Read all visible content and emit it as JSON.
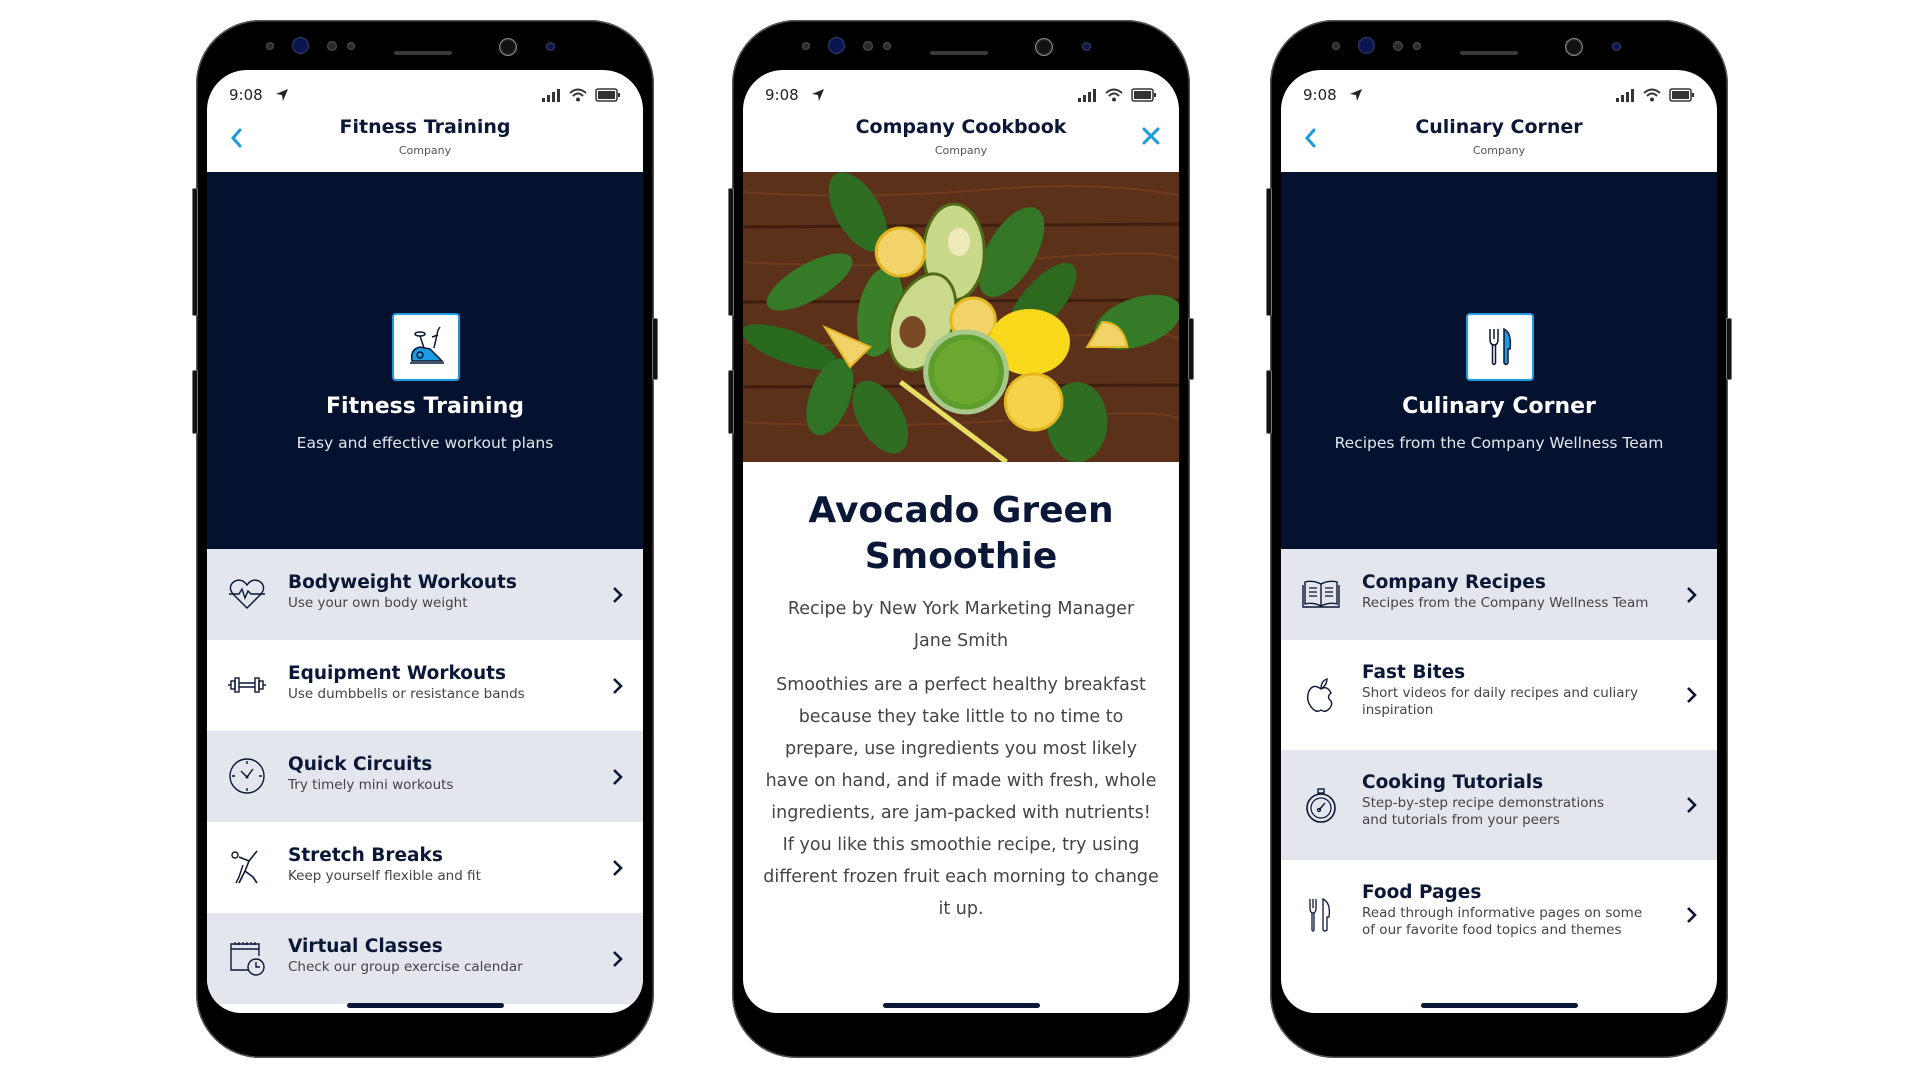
{
  "colors": {
    "accent": "#1b9be0",
    "navy": "#0b1736",
    "hero_bg": "#04122f",
    "row_alt": "#e3e6ec"
  },
  "phones": [
    {
      "status": {
        "time": "9:08",
        "icons": [
          "location-arrow-icon",
          "signal-icon",
          "wifi-icon",
          "battery-icon"
        ]
      },
      "header": {
        "title": "Fitness Training",
        "subtitle": "Company",
        "nav_icon": "back-chevron-icon"
      },
      "hero": {
        "icon": "exercise-bike-icon",
        "title": "Fitness Training",
        "subtitle": "Easy and effective workout plans"
      },
      "items": [
        {
          "icon": "heart-pulse-icon",
          "title": "Bodyweight Workouts",
          "subtitle": "Use your own body weight"
        },
        {
          "icon": "dumbbell-icon",
          "title": "Equipment Workouts",
          "subtitle": "Use dumbbells or resistance bands"
        },
        {
          "icon": "clock-icon",
          "title": "Quick Circuits",
          "subtitle": "Try timely mini workouts"
        },
        {
          "icon": "stretching-person-icon",
          "title": "Stretch Breaks",
          "subtitle": "Keep yourself flexible and fit"
        },
        {
          "icon": "calendar-clock-icon",
          "title": "Virtual Classes",
          "subtitle": "Check our group exercise calendar"
        }
      ]
    },
    {
      "status": {
        "time": "9:08",
        "icons": [
          "location-arrow-icon",
          "signal-icon",
          "wifi-icon",
          "battery-icon"
        ]
      },
      "header": {
        "title": "Company Cookbook",
        "subtitle": "Company",
        "nav_icon": "close-icon"
      },
      "article": {
        "image": "avocado-smoothie-photo",
        "title": "Avocado Green Smoothie",
        "byline": "Recipe by New York Marketing Manager Jane Smith",
        "body": "Smoothies are a perfect healthy breakfast because they take little to no time to prepare, use ingredients you most likely have on hand, and if made with fresh, whole ingredients, are jam-packed with nutrients! If you like this smoothie recipe, try using different frozen fruit each morning to change it up."
      }
    },
    {
      "status": {
        "time": "9:08",
        "icons": [
          "location-arrow-icon",
          "signal-icon",
          "wifi-icon",
          "battery-icon"
        ]
      },
      "header": {
        "title": "Culinary Corner",
        "subtitle": "Company",
        "nav_icon": "back-chevron-icon"
      },
      "hero": {
        "icon": "fork-knife-icon",
        "title": "Culinary Corner",
        "subtitle": "Recipes from the Company Wellness Team"
      },
      "items": [
        {
          "icon": "open-book-icon",
          "title": "Company Recipes",
          "subtitle": "Recipes from the Company Wellness Team"
        },
        {
          "icon": "apple-icon",
          "title": "Fast Bites",
          "subtitle": "Short videos for daily recipes and culiary inspiration"
        },
        {
          "icon": "stopwatch-icon",
          "title": "Cooking Tutorials",
          "subtitle": "Step-by-step recipe demonstrations and tutorials from your peers"
        },
        {
          "icon": "fork-knife-icon",
          "title": "Food Pages",
          "subtitle": "Read through informative pages on some of our favorite food topics and themes"
        }
      ]
    }
  ]
}
